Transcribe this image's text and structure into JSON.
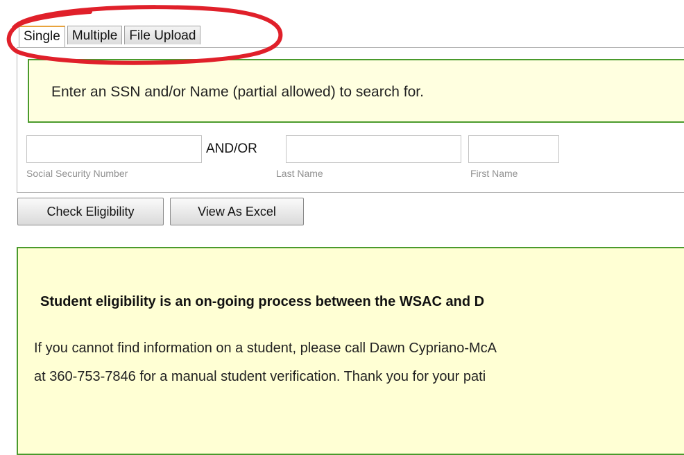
{
  "tabs": [
    {
      "label": "Single",
      "active": true
    },
    {
      "label": "Multiple",
      "active": false
    },
    {
      "label": "File Upload",
      "active": false
    }
  ],
  "instructions": "Enter an SSN and/or Name (partial allowed) to search for.",
  "fields": {
    "ssn": {
      "value": "",
      "label": "Social Security Number"
    },
    "andor": "AND/OR",
    "last_name": {
      "value": "",
      "label": "Last Name"
    },
    "first_name": {
      "value": "",
      "label": "First Name"
    }
  },
  "buttons": {
    "check": "Check Eligibility",
    "excel": "View As Excel"
  },
  "notice": {
    "title": "Student eligibility is an on-going process between the WSAC and D",
    "line1": "If you cannot find information on a student, please call Dawn Cypriano-McA",
    "line2": "at 360-753-7846 for a manual student verification. Thank you for your pati"
  },
  "colors": {
    "annotation_circle": "#e0202a",
    "panel_background": "#ffffe0",
    "panel_border": "#4a9a2c",
    "active_tab_accent": "#e8a33d"
  }
}
